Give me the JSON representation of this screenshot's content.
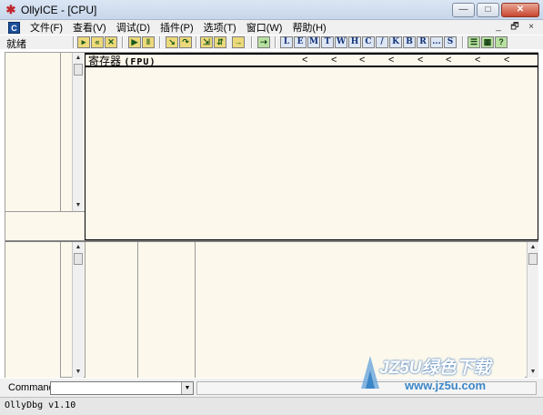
{
  "window": {
    "title": "OllyICE - [CPU]",
    "app_icon": "bug-icon",
    "controls": {
      "minimize": "—",
      "maximize": "□",
      "close": "✕"
    }
  },
  "menubar": {
    "cpu_icon_label": "C",
    "items": [
      "文件(F)",
      "查看(V)",
      "调试(D)",
      "插件(P)",
      "选项(T)",
      "窗口(W)",
      "帮助(H)"
    ],
    "mdi_controls": {
      "minimize": "_",
      "restore": "🗗",
      "close": "×"
    }
  },
  "toolbar": {
    "status": "就绪",
    "debug_buttons": [
      "open",
      "restart",
      "close",
      "run",
      "pause",
      "step-into",
      "step-over",
      "trace-into",
      "trace-over",
      "execute-till-return",
      "go-to"
    ],
    "window_buttons": [
      "L",
      "E",
      "M",
      "T",
      "W",
      "H",
      "C",
      "/",
      "K",
      "B",
      "R",
      "...",
      "S"
    ],
    "extra_buttons": [
      "list",
      "options",
      "help"
    ]
  },
  "registers_pane": {
    "title_prefix": "寄存器",
    "title_mode": "(FPU)",
    "arrows": [
      "<",
      "<",
      "<",
      "<",
      "<",
      "<",
      "<",
      "<"
    ]
  },
  "command_bar": {
    "label": "Command",
    "value": ""
  },
  "statusbar": {
    "text": "OllyDbg v1.10"
  },
  "watermark": {
    "brand": "JZ5U绿色下载",
    "url": "www.jz5u.com"
  }
}
